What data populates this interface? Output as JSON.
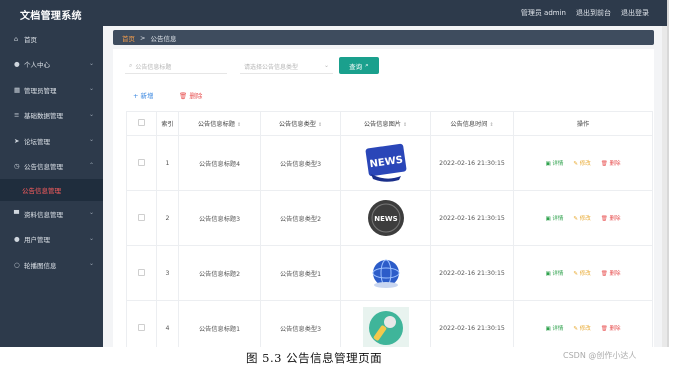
{
  "app": {
    "title": "文档管理系统"
  },
  "topbar": {
    "user": "管理员 admin",
    "back_link": "退出到前台",
    "logout_link": "退出登录"
  },
  "sidebar": {
    "items": [
      {
        "label": "首页",
        "icon": "home-icon",
        "glyph": "⌂"
      },
      {
        "label": "个人中心",
        "icon": "user-icon",
        "glyph": "●"
      },
      {
        "label": "管理员管理",
        "icon": "grid-icon",
        "glyph": "▦"
      },
      {
        "label": "基础数据管理",
        "icon": "list-icon",
        "glyph": "≡"
      },
      {
        "label": "论坛管理",
        "icon": "send-icon",
        "glyph": "➤"
      },
      {
        "label": "公告信息管理",
        "icon": "clock-icon",
        "glyph": "◷"
      },
      {
        "label": "公告信息管理",
        "icon": "",
        "glyph": ""
      },
      {
        "label": "资料信息管理",
        "icon": "monitor-icon",
        "glyph": "▀"
      },
      {
        "label": "用户管理",
        "icon": "user-icon",
        "glyph": "●"
      },
      {
        "label": "轮播图信息",
        "icon": "circle-icon",
        "glyph": "○"
      }
    ]
  },
  "breadcrumb": {
    "home": "首页",
    "sep": ">",
    "current": "公告信息"
  },
  "search": {
    "title_placeholder": "公告信息标题",
    "type_placeholder": "请选择公告信息类型",
    "query_label": "查询"
  },
  "actions": {
    "add_label": "新增",
    "delete_label": "删除"
  },
  "table": {
    "headers": [
      "",
      "索引",
      "公告信息标题",
      "公告信息类型",
      "公告信息图片",
      "公告信息时间",
      "操作"
    ],
    "ops": {
      "detail": "详情",
      "edit": "修改",
      "remove": "删除"
    },
    "rows": [
      {
        "index": "1",
        "title": "公告信息标题4",
        "type": "公告信息类型3",
        "image": "news-banner",
        "time": "2022-02-16 21:30:15"
      },
      {
        "index": "2",
        "title": "公告信息标题3",
        "type": "公告信息类型2",
        "image": "news-circle",
        "time": "2022-02-16 21:30:15"
      },
      {
        "index": "3",
        "title": "公告信息标题2",
        "type": "公告信息类型1",
        "image": "globe",
        "time": "2022-02-16 21:30:15"
      },
      {
        "index": "4",
        "title": "公告信息标题1",
        "type": "公告信息类型3",
        "image": "microphone",
        "time": "2022-02-16 21:30:15"
      }
    ]
  },
  "caption": "图 5.3  公告信息管理页面",
  "watermark": "CSDN @创作小达人",
  "colors": {
    "sidebar": "#2d3a4b",
    "accent": "#1aa08d",
    "active_menu": "#ff5e5e",
    "breadcrumb_home": "#f29b4b"
  }
}
